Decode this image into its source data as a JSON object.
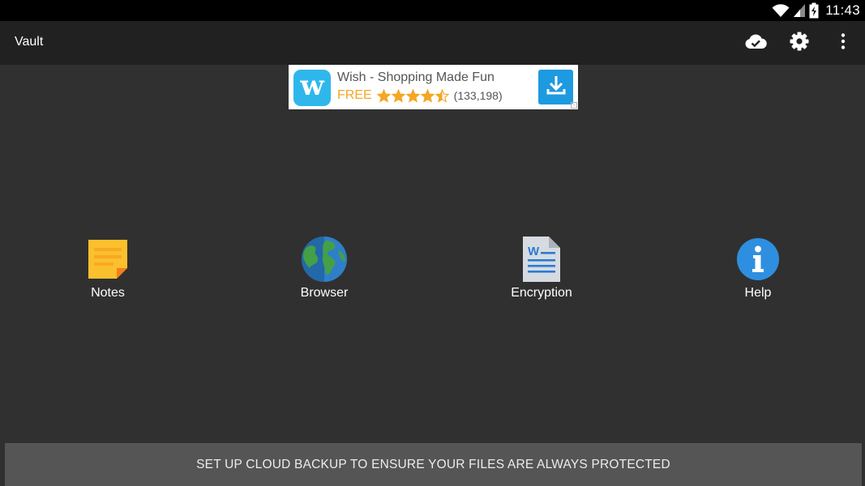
{
  "status_bar": {
    "time": "11:43",
    "icons": [
      "wifi-icon",
      "signal-icon",
      "battery-charging-icon"
    ]
  },
  "app_bar": {
    "title": "Vault",
    "actions": [
      {
        "name": "cloud-done-icon"
      },
      {
        "name": "gear-icon"
      },
      {
        "name": "more-vert-icon"
      }
    ]
  },
  "ad": {
    "title": "Wish - Shopping Made Fun",
    "price": "FREE",
    "rating": 4.5,
    "rating_max": 5,
    "review_count": "(133,198)",
    "logo_letter": "w",
    "colors": {
      "logo": "#2fb7ec",
      "price": "#f5a623",
      "download": "#1e9ae0"
    }
  },
  "tiles": [
    {
      "label": "Notes",
      "icon": "sticky-note-icon"
    },
    {
      "label": "Browser",
      "icon": "globe-icon"
    },
    {
      "label": "Encryption",
      "icon": "word-document-icon"
    },
    {
      "label": "Help",
      "icon": "info-icon"
    }
  ],
  "backup_banner": {
    "text": "SET UP CLOUD BACKUP TO ENSURE YOUR FILES ARE ALWAYS PROTECTED"
  },
  "colors": {
    "background": "#303030",
    "app_bar": "#212121",
    "status_bar": "#000000",
    "banner": "#555555"
  }
}
